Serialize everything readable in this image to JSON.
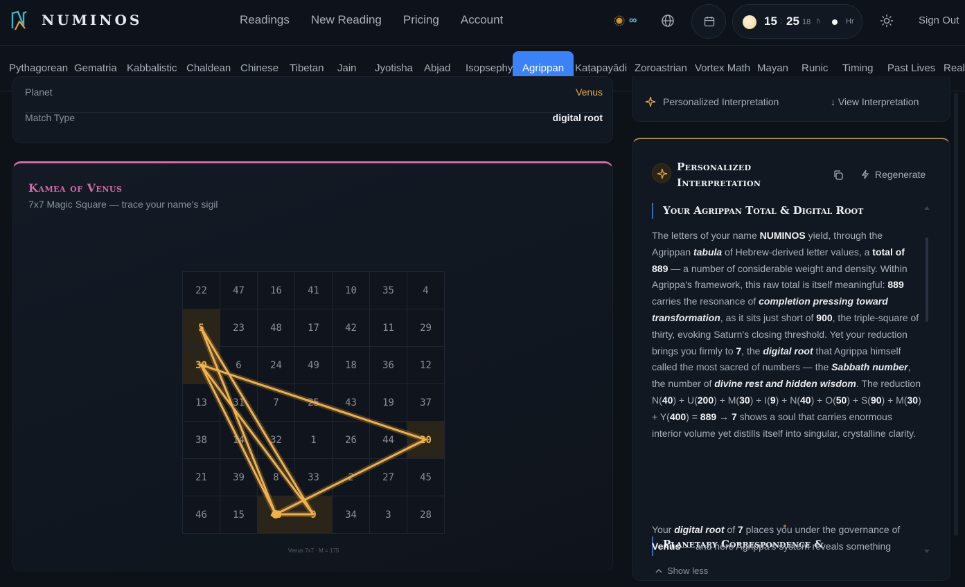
{
  "brand": {
    "name": "NUMINOS"
  },
  "nav": {
    "items": [
      "Readings",
      "New Reading",
      "Pricing",
      "Account"
    ]
  },
  "credits": {
    "value": "∞"
  },
  "clock": {
    "hours": "15",
    "separator": ";",
    "minutes": "25",
    "seconds": "18",
    "glyph": "ħ",
    "unit": "Hr"
  },
  "signout": "Sign Out",
  "systems": {
    "tabs": [
      "Pythagorean",
      "Gematria",
      "Kabbalistic",
      "Chaldean",
      "Chinese",
      "Tibetan",
      "Jain",
      "Jyotisha",
      "Abjad",
      "Isopsephy",
      "Agrippan",
      "Kaṭapayādi",
      "Zoroastrian",
      "Vortex Math",
      "Mayan",
      "Runic",
      "Timing",
      "Past Lives",
      "Reali"
    ],
    "active": "Agrippan"
  },
  "details": {
    "rows": [
      {
        "key": "Planet",
        "value": "Venus"
      },
      {
        "key": "Match Type",
        "value": "digital root"
      }
    ]
  },
  "kamea": {
    "title": "Kamea of Venus",
    "subtitle": "7x7 Magic Square — trace your name's sigil",
    "grid": [
      [
        22,
        47,
        16,
        41,
        10,
        35,
        4
      ],
      [
        5,
        23,
        48,
        17,
        42,
        11,
        29
      ],
      [
        30,
        6,
        24,
        49,
        18,
        36,
        12
      ],
      [
        13,
        31,
        7,
        25,
        43,
        19,
        37
      ],
      [
        38,
        14,
        32,
        1,
        26,
        44,
        20
      ],
      [
        21,
        39,
        8,
        33,
        2,
        27,
        45
      ],
      [
        46,
        15,
        40,
        9,
        34,
        3,
        28
      ]
    ],
    "highlighted": [
      5,
      30,
      20,
      40,
      9
    ],
    "sigil_path": [
      5,
      9,
      30,
      20,
      40,
      9,
      30,
      40,
      5
    ],
    "caption": "Venus 7x7 · M = 175",
    "accent": "#d46aa8",
    "trace_color": "#f0b14c"
  },
  "interpretation": {
    "bar_label": "Personalized Interpretation",
    "bar_link": "View Interpretation",
    "title": "Personalized Interpretation",
    "regenerate": "Regenerate",
    "sections": [
      {
        "title": "Your Agrippan Total & Digital Root"
      },
      {
        "title": "Planetary Correspondence & Renaissance Magic"
      }
    ],
    "show_less": "Show less"
  }
}
